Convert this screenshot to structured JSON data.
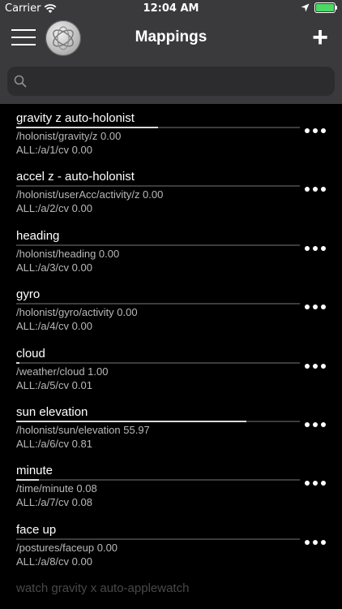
{
  "status_bar": {
    "carrier": "Carrier",
    "time": "12:04 AM",
    "battery_level": 1.0
  },
  "nav": {
    "title": "Mappings"
  },
  "search": {
    "placeholder": ""
  },
  "mappings": [
    {
      "name": "gravity z auto-holonist",
      "source": "/holonist/gravity/z 0.00",
      "destination": "ALL:/a/1/cv 0.00",
      "level": 0.5
    },
    {
      "name": "accel z - auto-holonist",
      "source": "/holonist/userAcc/activity/z 0.00",
      "destination": "ALL:/a/2/cv 0.00",
      "level": 0
    },
    {
      "name": "heading",
      "source": "/holonist/heading 0.00",
      "destination": "ALL:/a/3/cv 0.00",
      "level": 0
    },
    {
      "name": "gyro",
      "source": "/holonist/gyro/activity 0.00",
      "destination": "ALL:/a/4/cv 0.00",
      "level": 0
    },
    {
      "name": "cloud",
      "source": "/weather/cloud 1.00",
      "destination": "ALL:/a/5/cv 0.01",
      "level": 0.01
    },
    {
      "name": "sun elevation",
      "source": "/holonist/sun/elevation 55.97",
      "destination": "ALL:/a/6/cv 0.81",
      "level": 0.81
    },
    {
      "name": "minute",
      "source": "/time/minute 0.08",
      "destination": "ALL:/a/7/cv 0.08",
      "level": 0.08
    },
    {
      "name": "face up",
      "source": "/postures/faceup 0.00",
      "destination": "ALL:/a/8/cv 0.00",
      "level": 0
    },
    {
      "name": "watch gravity x auto-applewatch"
    }
  ]
}
